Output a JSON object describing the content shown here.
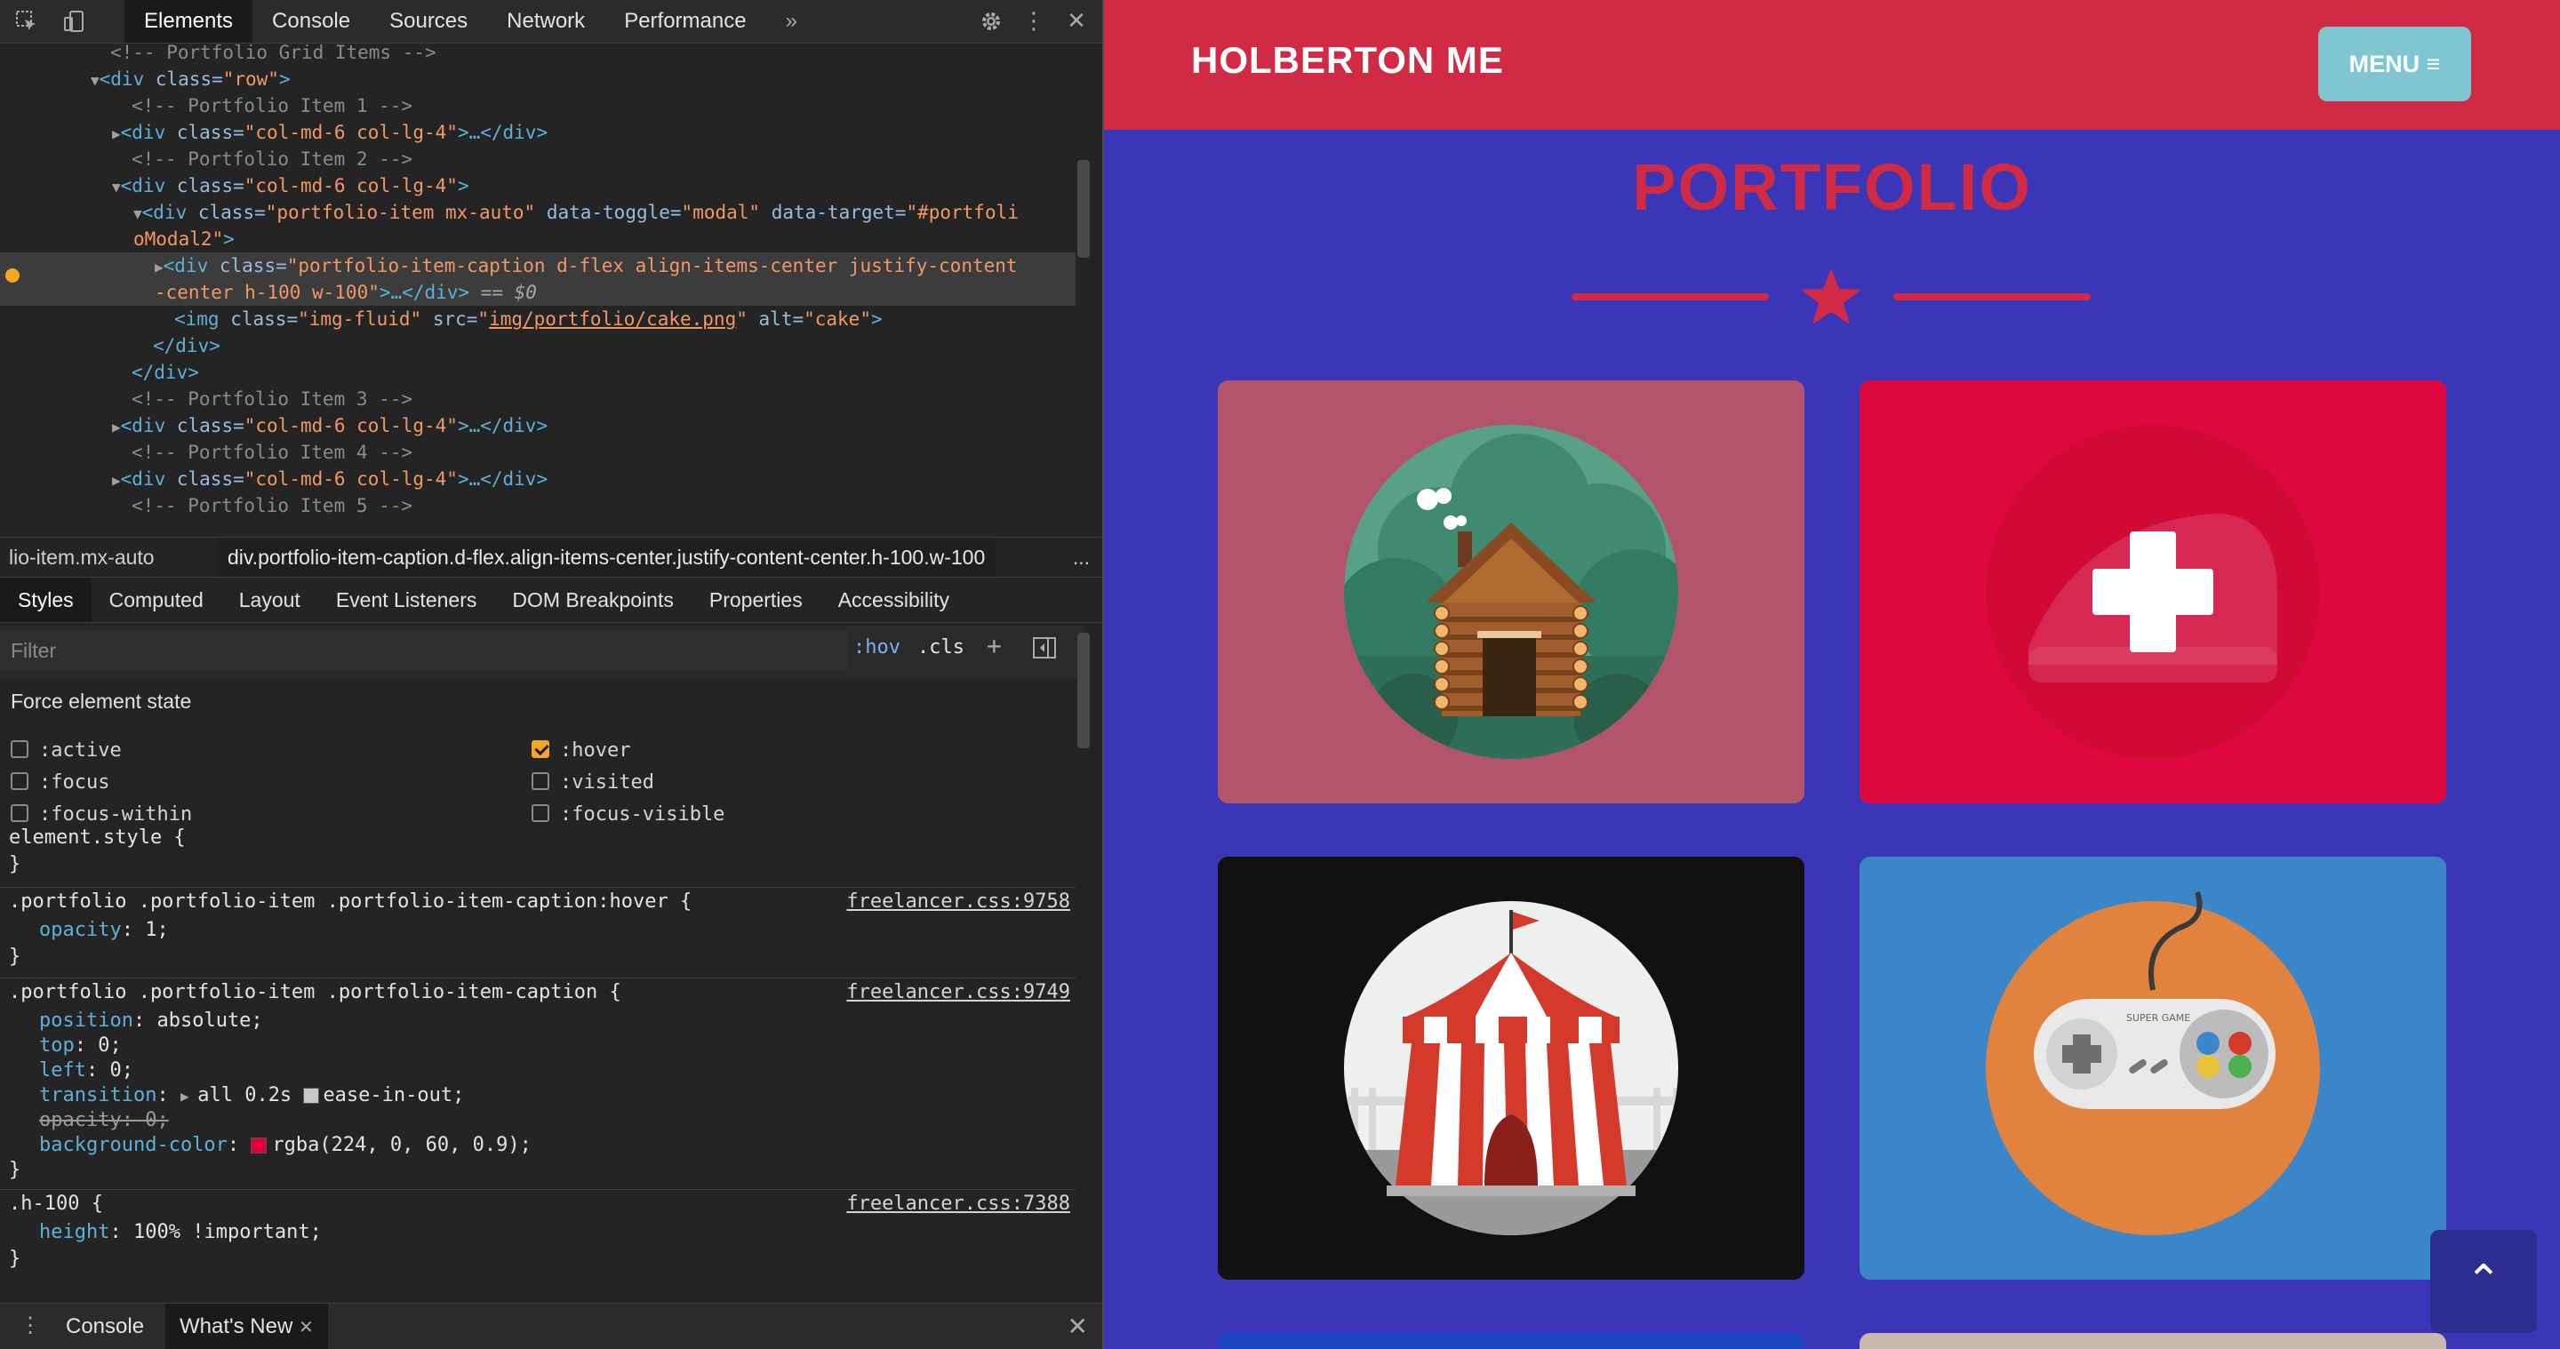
{
  "devtools": {
    "tabs": [
      "Elements",
      "Console",
      "Sources",
      "Network",
      "Performance"
    ],
    "tabs_overflow": "»",
    "breadcrumbs": {
      "first": "lio-item.mx-auto",
      "second": "div.portfolio-item-caption.d-flex.align-items-center.justify-content-center.h-100.w-100",
      "more": "..."
    },
    "sub_tabs": [
      "Styles",
      "Computed",
      "Layout",
      "Event Listeners",
      "DOM Breakpoints",
      "Properties",
      "Accessibility"
    ],
    "filter_placeholder": "Filter",
    "hov": ":hov",
    "cls": ".cls",
    "force_state_title": "Force element state",
    "states": {
      "active": ":active",
      "focus": ":focus",
      "focus_within": ":focus-within",
      "hover": ":hover",
      "visited": ":visited",
      "focus_visible": ":focus-visible"
    },
    "hover_checked": true,
    "dom": {
      "l0": "<!-- Portfolio Grid Items -->",
      "l1_tag": "<div",
      "l1_attr": "class=",
      "l1_val": "\"row\"",
      "l1_end": ">",
      "l2": "<!-- Portfolio Item 1 -->",
      "l3_val": "\"col-md-6 col-lg-4\"",
      "l3_rest": ">…</div>",
      "l4": "<!-- Portfolio Item 2 -->",
      "l5_val": "\"col-md-6 col-lg-4\"",
      "l6_val1": "\"portfolio-item mx-auto\"",
      "l6_attr2": "data-toggle=",
      "l6_val2": "\"modal\"",
      "l6_attr3": "data-target=",
      "l6_val3": "\"#portfoli",
      "l6b_val3": "oModal2\"",
      "l7_val": "\"portfolio-item-caption d-flex align-items-center justify-content",
      "l7b_val": "-center h-100 w-100\"",
      "l7b_rest": ">…</div>",
      "l7b_eq": " == $0",
      "l8_tag": "<img",
      "l8_attr1": "class=",
      "l8_val1": "\"img-fluid\"",
      "l8_attr2": "src=",
      "l8_val2": "img/portfolio/cake.png",
      "l8_attr3": "alt=",
      "l8_val3": "\"cake\"",
      "close_div": "</div>",
      "l11": "<!-- Portfolio Item 3 -->",
      "l13": "<!-- Portfolio Item 4 -->",
      "l15": "<!-- Portfolio Item 5 -->"
    },
    "rules": {
      "element_style": "element.style {",
      "hover_selector": ".portfolio .portfolio-item .portfolio-item-caption:hover {",
      "hover_src": "freelancer.css:9758",
      "hover_prop": "opacity",
      "hover_val": "1;",
      "caption_selector": ".portfolio .portfolio-item .portfolio-item-caption {",
      "caption_src": "freelancer.css:9749",
      "props": {
        "position": "absolute;",
        "top": "0;",
        "left": "0;",
        "transition_a": "all 0.2s",
        "transition_b": "ease-in-out;",
        "opacity_struck": "opacity: 0;",
        "bg": "rgba(224, 0, 60, 0.9);"
      },
      "h100_selector": ".h-100 {",
      "h100_src": "freelancer.css:7388",
      "h100_prop": "height",
      "h100_val": "100% !important;",
      "close_brace": "}"
    },
    "drawer": {
      "console": "Console",
      "whats_new": "What's New"
    }
  },
  "page": {
    "brand": "HOLBERTON ME",
    "menu": "MENU",
    "title": "PORTFOLIO",
    "colors": {
      "navbar": "#d12a45",
      "background": "#3b36b8",
      "menu_button": "#7fc6d2",
      "caption_overlay": "rgba(224, 0, 60, 0.9)"
    },
    "cards": [
      {
        "name": "cabin",
        "alt": "cabin"
      },
      {
        "name": "cake",
        "alt": "cake",
        "hovered": true
      },
      {
        "name": "circus",
        "alt": "circus"
      },
      {
        "name": "game",
        "alt": "game",
        "label": "SUPER GAME"
      }
    ]
  }
}
